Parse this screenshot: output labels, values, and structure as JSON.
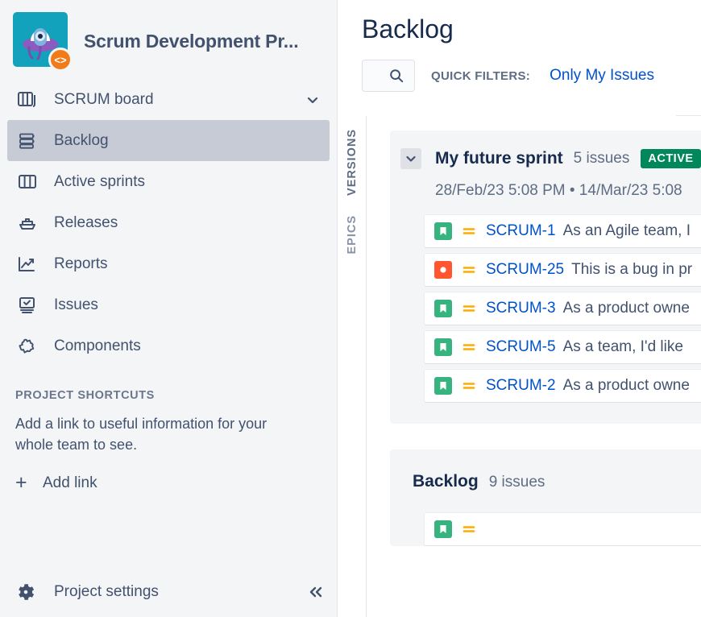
{
  "sidebar": {
    "project": {
      "name": "Scrum Development Pr...",
      "avatar_icon": "ufo-avatar-icon",
      "avatar_bg": "#13A2BB",
      "badge_icon": "code-badge-icon",
      "badge_bg": "#F07B18",
      "badge_glyph": "<>"
    },
    "nav": [
      {
        "label": "SCRUM board",
        "icon": "board-stack-icon",
        "selected": false,
        "has_chevron": true
      },
      {
        "label": "Backlog",
        "icon": "backlog-layers-icon",
        "selected": true,
        "has_chevron": false
      },
      {
        "label": "Active sprints",
        "icon": "columns-icon",
        "selected": false,
        "has_chevron": false
      },
      {
        "label": "Releases",
        "icon": "ship-icon",
        "selected": false,
        "has_chevron": false
      },
      {
        "label": "Reports",
        "icon": "chart-trend-icon",
        "selected": false,
        "has_chevron": false
      },
      {
        "label": "Issues",
        "icon": "issues-check-icon",
        "selected": false,
        "has_chevron": false
      },
      {
        "label": "Components",
        "icon": "puzzle-icon",
        "selected": false,
        "has_chevron": false
      }
    ],
    "shortcuts": {
      "heading": "PROJECT SHORTCUTS",
      "description": "Add a link to useful information for your whole team to see.",
      "add_link_label": "Add link",
      "add_link_icon": "plus-icon"
    },
    "footer": {
      "settings_label": "Project settings",
      "settings_icon": "gear-icon",
      "collapse_icon": "double-chevron-left-icon"
    }
  },
  "main": {
    "page_title": "Backlog",
    "search": {
      "placeholder": "",
      "value": "",
      "icon": "search-icon"
    },
    "quick_filters_label": "QUICK FILTERS:",
    "quick_filters": [
      {
        "label": "Only My Issues",
        "active": false
      }
    ],
    "side_tabs": [
      {
        "label": "VERSIONS"
      },
      {
        "label": "EPICS"
      }
    ],
    "sprint": {
      "collapse_icon": "chevron-down-icon",
      "name": "My future sprint",
      "issue_count": "5 issues",
      "status_badge": "ACTIVE",
      "status_color": "#00875A",
      "dates": "28/Feb/23 5:08 PM  •  14/Mar/23 5:08",
      "issues": [
        {
          "type": "story",
          "type_icon": "story-bookmark-icon",
          "priority_icon": "priority-medium-icon",
          "key": "SCRUM-1",
          "summary": "As an Agile team, I"
        },
        {
          "type": "bug",
          "type_icon": "bug-circle-icon",
          "priority_icon": "priority-medium-icon",
          "key": "SCRUM-25",
          "summary": "This is a bug in pr"
        },
        {
          "type": "story",
          "type_icon": "story-bookmark-icon",
          "priority_icon": "priority-medium-icon",
          "key": "SCRUM-3",
          "summary": "As a product owne"
        },
        {
          "type": "story",
          "type_icon": "story-bookmark-icon",
          "priority_icon": "priority-medium-icon",
          "key": "SCRUM-5",
          "summary": "As a team, I'd like"
        },
        {
          "type": "story",
          "type_icon": "story-bookmark-icon",
          "priority_icon": "priority-medium-icon",
          "key": "SCRUM-2",
          "summary": "As a product owne"
        }
      ]
    },
    "backlog_section": {
      "title": "Backlog",
      "issue_count": "9 issues",
      "issues": [
        {
          "type": "story",
          "type_icon": "story-bookmark-icon",
          "priority_icon": "priority-medium-icon",
          "key": "",
          "summary": ""
        }
      ]
    }
  },
  "colors": {
    "brand_blue": "#0052CC",
    "text_primary": "#172B4D",
    "text_subtle": "#5E6C84",
    "sidebar_bg": "#F4F5F7",
    "selected_bg": "#C6CBD5",
    "story_green": "#36B37E",
    "bug_red": "#FF5630",
    "priority_orange": "#FFAB00"
  }
}
